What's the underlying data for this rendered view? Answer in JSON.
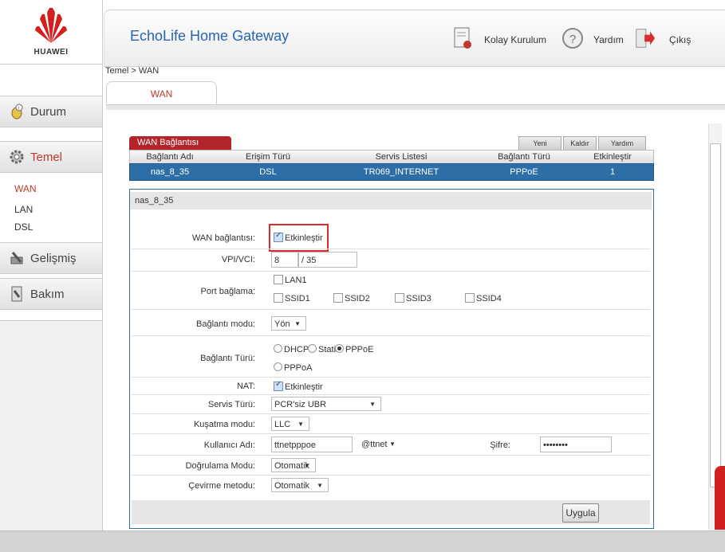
{
  "brand": {
    "name": "HUAWEI"
  },
  "header": {
    "title": "EchoLife Home Gateway",
    "wizard_label": "Kolay Kurulum",
    "help_label": "Yardım",
    "logout_label": "Çıkış"
  },
  "breadcrumb": "Temel > WAN",
  "tab": {
    "label": "WAN"
  },
  "sidebar": {
    "durum": "Durum",
    "temel": "Temel",
    "sub": [
      "WAN",
      "LAN",
      "DSL"
    ],
    "gelismis": "Gelişmiş",
    "bakim": "Bakım"
  },
  "wan_table": {
    "title": "WAN Bağlantısı",
    "buttons": {
      "new": "Yeni",
      "remove": "Kaldır",
      "help": "Yardım"
    },
    "columns": [
      "Bağlantı Adı",
      "Erişim Türü",
      "Servis Listesi",
      "Bağlantı Türü",
      "Etkinleştir"
    ],
    "rows": [
      [
        "nas_8_35",
        "DSL",
        "TR069_INTERNET",
        "PPPoE",
        "1"
      ]
    ]
  },
  "form": {
    "title": "nas_8_35",
    "wan_conn_label": "WAN bağlantısı:",
    "enable_label": "Etkinleştir",
    "vpi_label": "VPI/VCI:",
    "vpi": "8",
    "vci_sep": "/",
    "vci": "35",
    "port_label": "Port bağlama:",
    "ports": [
      "LAN1",
      "SSID1",
      "SSID2",
      "SSID3",
      "SSID4"
    ],
    "conn_mode_label": "Bağlantı modu:",
    "conn_mode": "Yön",
    "conn_type_label": "Bağlantı Türü:",
    "conn_types": [
      "DHCP",
      "Statik",
      "PPPoE",
      "PPPoA"
    ],
    "nat_label": "NAT:",
    "nat_enable": "Etkinleştir",
    "service_type_label": "Servis Türü:",
    "service_type": "PCR'siz UBR",
    "encap_label": "Kuşatma modu:",
    "encap": "LLC",
    "user_label": "Kullanıcı Adı:",
    "user": "ttnetpppoe",
    "domain": "@ttnet",
    "pass_label": "Şifre:",
    "pass": "••••••••",
    "auth_label": "Doğrulama Modu:",
    "auth": "Otomatik",
    "dial_label": "Çevirme metodu:",
    "dial": "Otomatik",
    "apply": "Uygula"
  },
  "colors": {
    "accent": "#c0392b",
    "row_selected": "#2e6ea6",
    "title_blue": "#2a64b1"
  }
}
